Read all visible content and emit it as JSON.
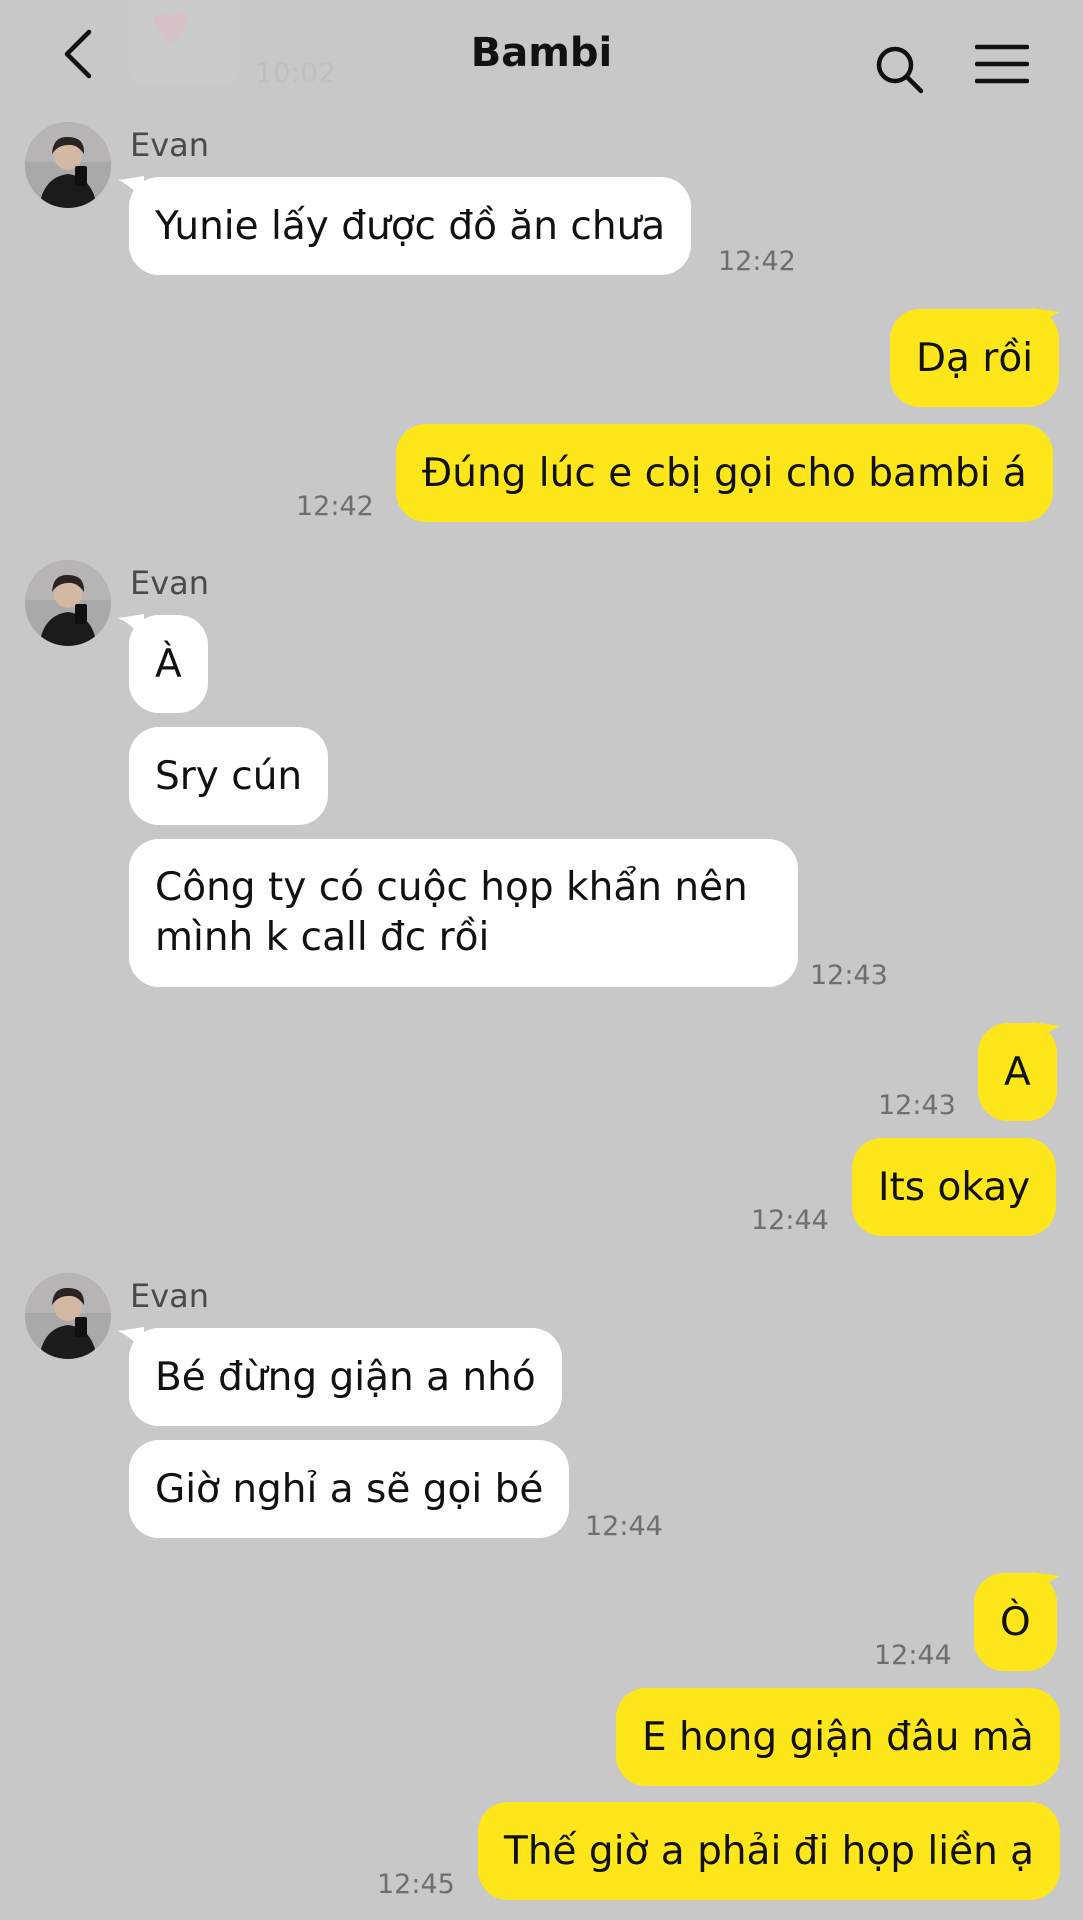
{
  "header": {
    "title": "Bambi",
    "prev_time": "10:02"
  },
  "colors": {
    "background": "#c8c8c8",
    "incoming_bubble": "#ffffff",
    "outgoing_bubble": "#fde71a"
  },
  "messages": [
    {
      "sender": "Evan",
      "text": "Yunie lấy được đồ ăn chưa",
      "time": "12:42"
    },
    {
      "text": "Dạ rồi"
    },
    {
      "text": "Đúng lúc e cbị gọi cho bambi á",
      "time": "12:42"
    },
    {
      "sender": "Evan",
      "text": "À"
    },
    {
      "text": "Sry cún"
    },
    {
      "text": "Công ty có cuộc họp khẩn nên mình k call đc rồi",
      "time": "12:43"
    },
    {
      "text": "A",
      "time": "12:43"
    },
    {
      "text": "Its okay",
      "time": "12:44"
    },
    {
      "sender": "Evan",
      "text": "Bé đừng giận a nhó"
    },
    {
      "text": "Giờ nghỉ a sẽ gọi bé",
      "time": "12:44"
    },
    {
      "text": "Ò",
      "time": "12:44"
    },
    {
      "text": "E hong giận đâu mà"
    },
    {
      "text": "Thế giờ a phải đi họp liền ạ",
      "time": "12:45"
    }
  ]
}
